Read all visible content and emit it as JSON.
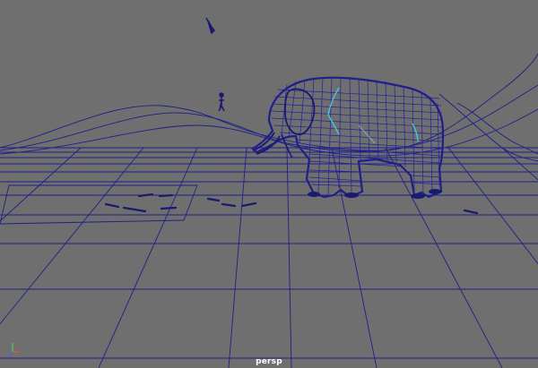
{
  "viewport": {
    "camera_label": "persp",
    "background_color": "#6f6f6f",
    "grid_color": "#c06060",
    "wire_color": "#1f1f8a",
    "highlight_color": "#44c4dd"
  },
  "axis_gizmo": {
    "icon": "axis-gizmo-icon",
    "x_color": "#e05050",
    "y_color": "#50c050",
    "z_color": "#4a6adf"
  }
}
